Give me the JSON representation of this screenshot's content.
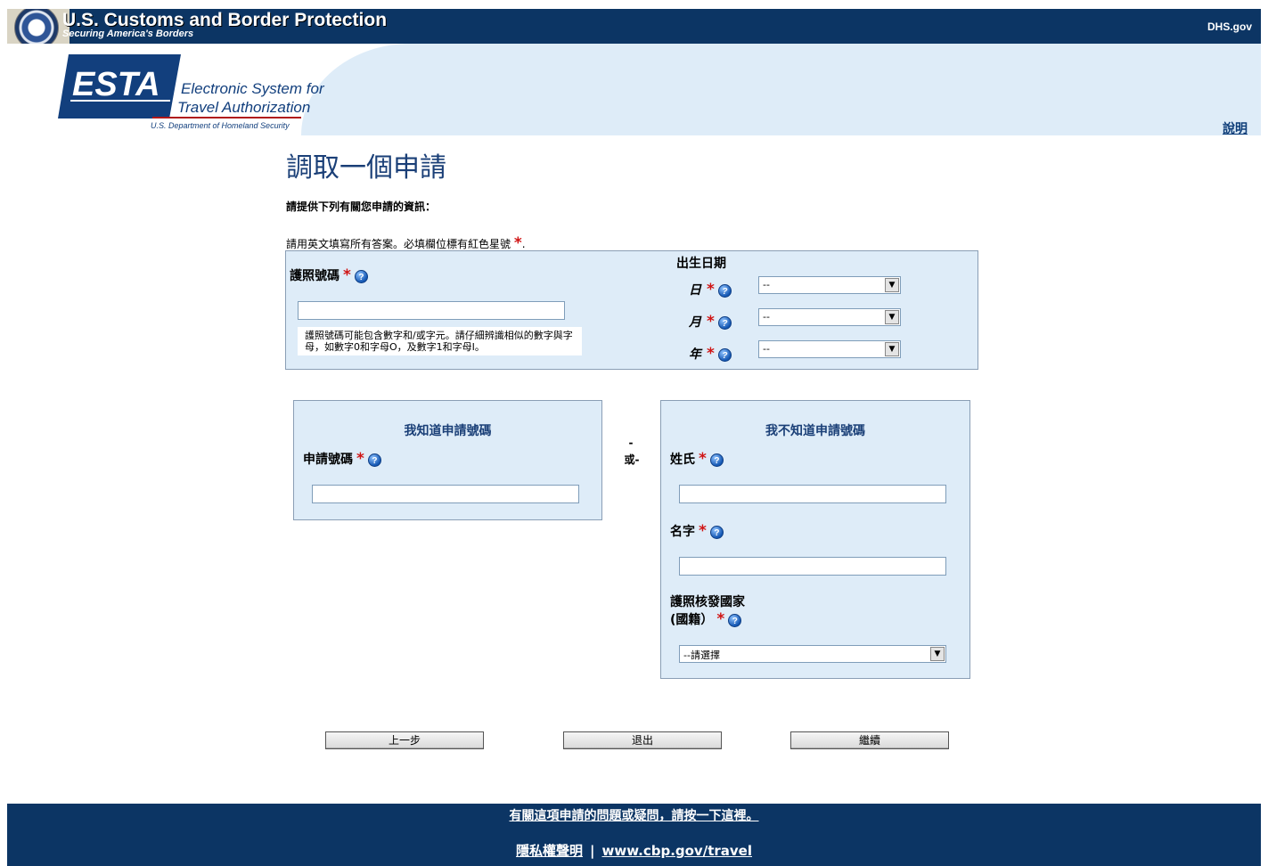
{
  "header": {
    "agency_title": "U.S. Customs and Border Protection",
    "agency_subtitle": "Securing America's Borders",
    "dhs_link": "DHS.gov",
    "esta_logo_text": "ESTA",
    "esta_full_line1": "Electronic System for",
    "esta_full_line2": "Travel Authorization",
    "esta_dept": "U.S. Department of Homeland Security",
    "help_link": "說明"
  },
  "page": {
    "title": "調取一個申請",
    "intro": "請提供下列有關您申請的資訊：",
    "instructions": "請用英文填寫所有答案。必填欄位標有紅色星號",
    "required_mark": "*",
    "period": "."
  },
  "passport_section": {
    "passport_label": "護照號碼",
    "passport_value": "",
    "passport_hint": "護照號碼可能包含數字和/或字元。請仔細辨識相似的數字與字母，如數字0和字母O，及數字1和字母I。",
    "dob_title": "出生日期",
    "day_label": "日",
    "month_label": "月",
    "year_label": "年",
    "day_value": "--",
    "month_value": "--",
    "year_value": "--"
  },
  "known_box": {
    "title": "我知道申請號碼",
    "app_number_label": "申請號碼",
    "app_number_value": ""
  },
  "or_separator": {
    "dash": "-",
    "text": "或-"
  },
  "unknown_box": {
    "title": "我不知道申請號碼",
    "surname_label": "姓氏",
    "surname_value": "",
    "given_name_label": "名字",
    "given_name_value": "",
    "country_label_line1": "護照核發國家",
    "country_label_line2": "(國籍）",
    "country_value": "--請選擇"
  },
  "buttons": {
    "previous": "上一步",
    "exit": "退出",
    "continue": "繼續"
  },
  "footer": {
    "question_link": "有關這項申請的問題或疑問，請按一下這裡。",
    "privacy_link": "隱私權聲明",
    "separator": "|",
    "cbp_link": "www.cbp.gov/travel"
  },
  "colors": {
    "navy": "#0c3564",
    "panel_blue": "#deecf8",
    "title_blue": "#1a3f77",
    "required_red": "#d01414"
  }
}
